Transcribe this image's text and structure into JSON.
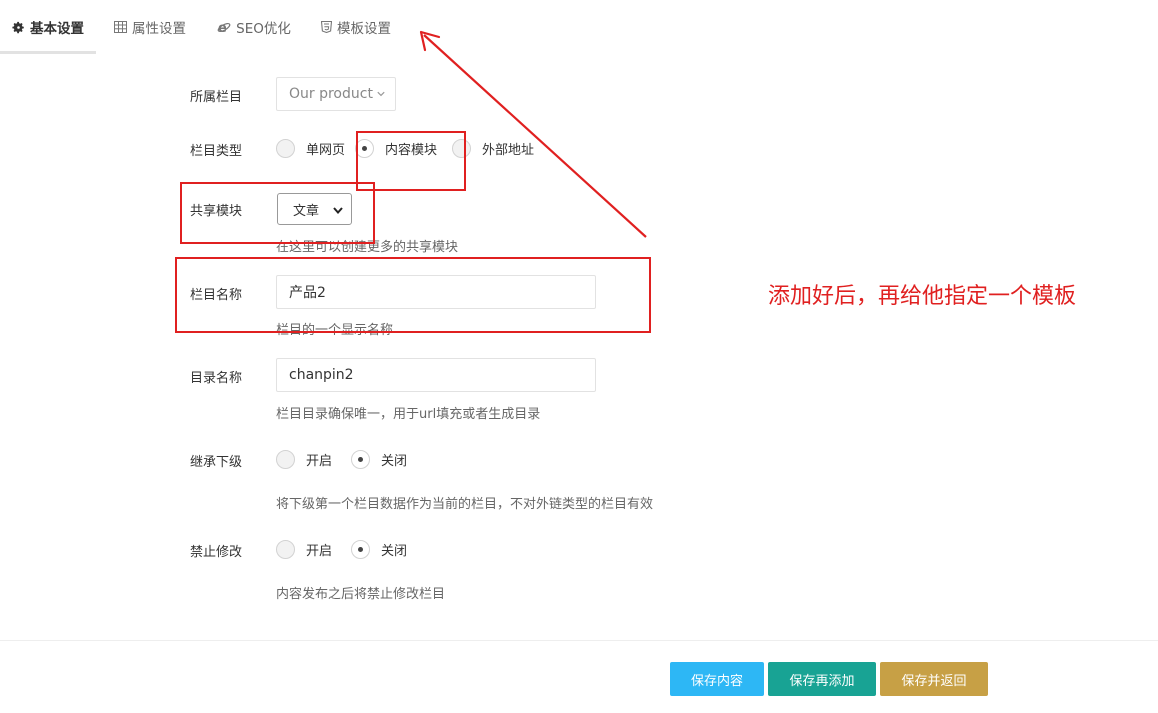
{
  "tabs": [
    {
      "label": "基本设置",
      "icon": "gear-icon",
      "active": true
    },
    {
      "label": "属性设置",
      "icon": "table-icon",
      "active": false
    },
    {
      "label": "SEO优化",
      "icon": "ie-browser-icon",
      "active": false
    },
    {
      "label": "模板设置",
      "icon": "html5-icon",
      "active": false
    }
  ],
  "form": {
    "parent_column": {
      "label": "所属栏目",
      "value": "Our product"
    },
    "column_type": {
      "label": "栏目类型",
      "options": [
        {
          "label": "单网页",
          "checked": false
        },
        {
          "label": "内容模块",
          "checked": true
        },
        {
          "label": "外部地址",
          "checked": false
        }
      ]
    },
    "shared_module": {
      "label": "共享模块",
      "value": "文章",
      "hint": "在这里可以创建更多的共享模块"
    },
    "column_name": {
      "label": "栏目名称",
      "value": "产品2",
      "hint": "栏目的一个显示名称"
    },
    "directory_name": {
      "label": "目录名称",
      "value": "chanpin2",
      "hint": "栏目目录确保唯一，用于url填充或者生成目录"
    },
    "inherit_sub": {
      "label": "继承下级",
      "options": [
        {
          "label": "开启",
          "checked": false
        },
        {
          "label": "关闭",
          "checked": true
        }
      ],
      "hint": "将下级第一个栏目数据作为当前的栏目，不对外链类型的栏目有效"
    },
    "forbid_edit": {
      "label": "禁止修改",
      "options": [
        {
          "label": "开启",
          "checked": false
        },
        {
          "label": "关闭",
          "checked": true
        }
      ],
      "hint": "内容发布之后将禁止修改栏目"
    }
  },
  "buttons": {
    "save": {
      "label": "保存内容",
      "color": "#2db7f5"
    },
    "save_add": {
      "label": "保存再添加",
      "color": "#18a394"
    },
    "save_return": {
      "label": "保存并返回",
      "color": "#c7a045"
    }
  },
  "annotation": {
    "text": "添加好后，再给他指定一个模板",
    "color": "#e02020"
  }
}
